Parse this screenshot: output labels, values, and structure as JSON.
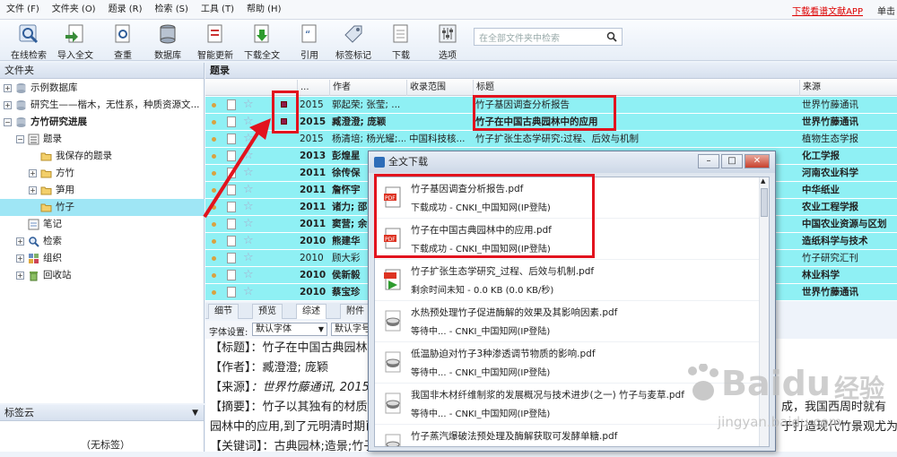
{
  "menubar": {
    "items": [
      "文件 (F)",
      "文件夹 (O)",
      "题录 (R)",
      "检索 (S)",
      "工具 (T)",
      "帮助 (H)"
    ],
    "app_link": "下载看谱文献APP",
    "login": "单击"
  },
  "toolbar": {
    "buttons": [
      "在线检索",
      "导入全文",
      "查重",
      "数据库",
      "智能更新",
      "下载全文",
      "引用",
      "标签标记",
      "下载",
      "选项"
    ],
    "search_placeholder": "在全部文件夹中检索"
  },
  "sidebar": {
    "title": "文件夹",
    "items": [
      "示例数据库",
      "研究生——楷木，无性系，种质资源文...",
      "方竹研究进展",
      "题录",
      "我保存的题录",
      "方竹",
      "笋用",
      "竹子",
      "笔记",
      "检索",
      "组织",
      "回收站"
    ]
  },
  "tag_cloud": {
    "title": "标签云",
    "empty": "（无标签）"
  },
  "list": {
    "title": "题录",
    "columns": [
      "...",
      "作者",
      "收录范围",
      "标题",
      "来源"
    ],
    "rows": [
      {
        "year": "2015",
        "authors": "郭起荣; 张莹; ...",
        "scope": "",
        "title": "竹子基因调查分析报告",
        "source": "世界竹藤通讯",
        "bold": false
      },
      {
        "year": "2015",
        "authors": "臧澄澄; 庞颖",
        "scope": "",
        "title": "竹子在中国古典园林中的应用",
        "source": "世界竹藤通讯",
        "bold": true
      },
      {
        "year": "2015",
        "authors": "杨清培; 杨光耀;...",
        "scope": "中国科技核...",
        "title": "竹子扩张生态学研究:过程、后效与机制",
        "source": "植物生态学报",
        "bold": false
      },
      {
        "year": "2013",
        "authors": "彭煌星",
        "scope": "",
        "title": "",
        "source": "化工学报",
        "bold": true
      },
      {
        "year": "2011",
        "authors": "徐传保",
        "scope": "",
        "title": "",
        "source": "河南农业科学",
        "bold": true
      },
      {
        "year": "2011",
        "authors": "詹怀宇",
        "scope": "",
        "title": "",
        "source": "中华纸业",
        "bold": true
      },
      {
        "year": "2011",
        "authors": "诸力; 邵",
        "scope": "",
        "title": "",
        "source": "农业工程学报",
        "bold": true
      },
      {
        "year": "2011",
        "authors": "窦营; 余",
        "scope": "",
        "title": "",
        "source": "中国农业资源与区划",
        "bold": true
      },
      {
        "year": "2010",
        "authors": "熊建华",
        "scope": "",
        "title": "",
        "source": "造纸科学与技术",
        "bold": true
      },
      {
        "year": "2010",
        "authors": "顾大彩",
        "scope": "",
        "title": "",
        "source": "竹子研究汇刊",
        "bold": false
      },
      {
        "year": "2010",
        "authors": "侯新毅",
        "scope": "",
        "title": "",
        "source": "林业科学",
        "bold": true
      },
      {
        "year": "2010",
        "authors": "蔡宝珍",
        "scope": "",
        "title": "",
        "source": "世界竹藤通讯",
        "bold": true
      }
    ]
  },
  "tabs": [
    "细节",
    "预览",
    "综述",
    "附件"
  ],
  "font_bar": {
    "label": "字体设置:",
    "font": "默认字体",
    "size": "默认字号"
  },
  "detail": {
    "title_label": "【标题】",
    "title_value": "：竹子在中国古典园林中",
    "author_label": "【作者】",
    "author_value": "：臧澄澄; 庞颖",
    "source_label": "【来源】",
    "source_value": "：世界竹藤通讯, 2015, ",
    "abstract_label": "【摘要】",
    "abstract_value": "：竹子以其独有的材质形",
    "abstract_tail": "成，我国西周时就有",
    "line5": "园林中的应用,到了元明清时期已",
    "line5_tail": "于打造现代竹景观尤为",
    "kw_label": "【关键词】",
    "kw_value": "：古典园林;造景;竹子"
  },
  "dialog": {
    "title": "全文下载",
    "items": [
      {
        "name": "竹子基因调查分析报告.pdf",
        "status": "下载成功  -  CNKI_中国知网(IP登陆)",
        "kind": "pdf"
      },
      {
        "name": "竹子在中国古典园林中的应用.pdf",
        "status": "下载成功  -  CNKI_中国知网(IP登陆)",
        "kind": "pdf"
      },
      {
        "name": "竹子扩张生态学研究_过程、后效与机制.pdf",
        "status": "剩余时间未知  -  0.0 KB (0.0 KB/秒)",
        "kind": "downloading"
      },
      {
        "name": "水热预处理竹子促进酶解的效果及其影响因素.pdf",
        "status": "等待中...  -  CNKI_中国知网(IP登陆)",
        "kind": "waiting"
      },
      {
        "name": "低温胁迫对竹子3种渗透调节物质的影响.pdf",
        "status": "等待中...  -  CNKI_中国知网(IP登陆)",
        "kind": "waiting"
      },
      {
        "name": "我国非木材纤维制浆的发展概况与技术进步(之一) 竹子与麦草.pdf",
        "status": "等待中...  -  CNKI_中国知网(IP登陆)",
        "kind": "waiting"
      },
      {
        "name": "竹子蒸汽爆破法预处理及酶解获取可发酵单糖.pdf",
        "status": "等待中...  -  CNKI_中国知网(IP登陆)",
        "kind": "waiting"
      }
    ]
  },
  "watermark": {
    "brand": "Baidu",
    "cn": "经验",
    "url": "jingyan.baidu.com"
  },
  "colors": {
    "row_highlight": "#8ff0f4",
    "annotation_red": "#e2131e",
    "selected_folder": "#9fe6f5"
  }
}
